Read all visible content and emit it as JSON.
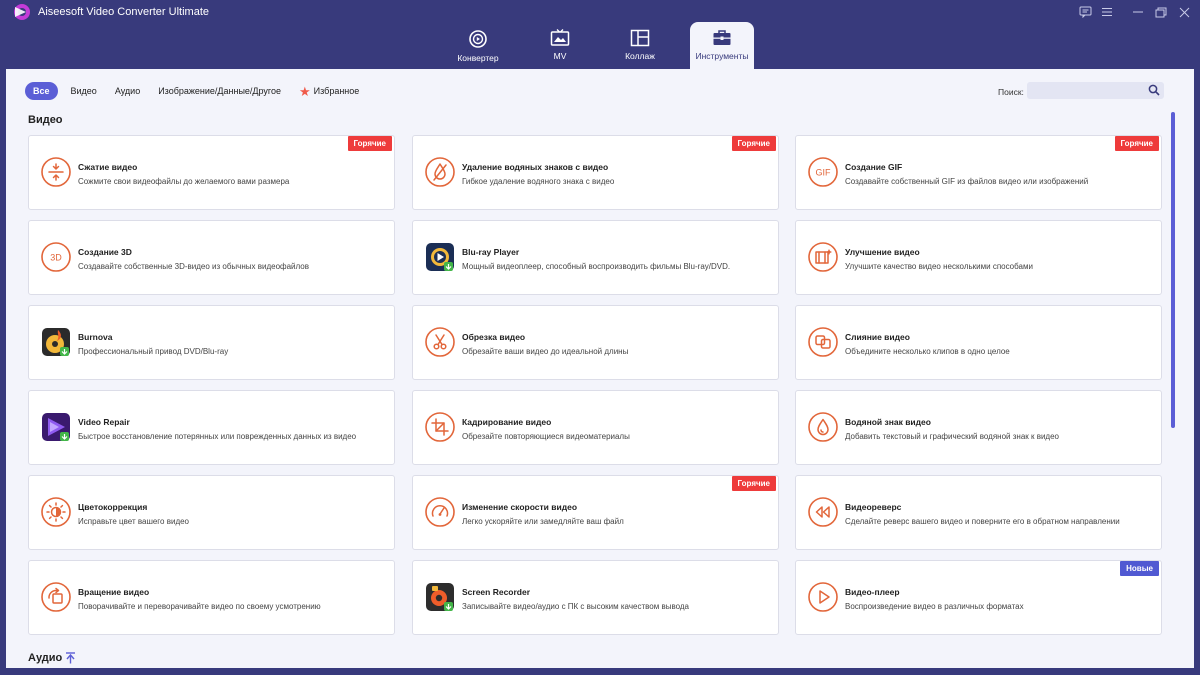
{
  "app": {
    "title": "Aiseesoft Video Converter Ultimate"
  },
  "nav": {
    "tabs": [
      {
        "label": "Конвертер",
        "icon": "convert-icon"
      },
      {
        "label": "MV",
        "icon": "mv-icon"
      },
      {
        "label": "Коллаж",
        "icon": "collage-icon"
      },
      {
        "label": "Инструменты",
        "icon": "toolbox-icon",
        "active": true
      }
    ]
  },
  "filters": {
    "all": "Все",
    "video": "Видео",
    "audio": "Аудио",
    "image": "Изображение/Данные/Другое",
    "favorites": "Избранное"
  },
  "search": {
    "label": "Поиск:",
    "value": ""
  },
  "sections": {
    "video": "Видео",
    "audio": "Аудио"
  },
  "badges": {
    "hot": "Горячие",
    "new": "Новые"
  },
  "tools": [
    {
      "title": "Сжатие видео",
      "desc": "Сожмите свои видеофайлы до желаемого вами размера",
      "icon": "compress-icon",
      "badge": "hot"
    },
    {
      "title": "Удаление водяных знаков с видео",
      "desc": "Гибкое удаление водяного знака с видео",
      "icon": "watermark-remove-icon",
      "badge": "hot"
    },
    {
      "title": "Создание GIF",
      "desc": "Создавайте собственный GIF из файлов видео или изображений",
      "icon": "gif-icon",
      "badge": "hot"
    },
    {
      "title": "Создание 3D",
      "desc": "Создавайте собственные 3D-видео из обычных видеофайлов",
      "icon": "3d-icon"
    },
    {
      "title": "Blu-ray Player",
      "desc": "Мощный видеоплеер, способный воспроизводить фильмы Blu-ray/DVD.",
      "icon": "bluray-player-app-icon"
    },
    {
      "title": "Улучшение видео",
      "desc": "Улучшите качество видео несколькими способами",
      "icon": "enhance-icon"
    },
    {
      "title": "Burnova",
      "desc": "Профессиональный привод DVD/Blu-ray",
      "icon": "burnova-app-icon"
    },
    {
      "title": "Обрезка видео",
      "desc": "Обрезайте ваши видео до идеальной длины",
      "icon": "trim-icon"
    },
    {
      "title": "Слияние видео",
      "desc": "Объедините несколько клипов в одно целое",
      "icon": "merge-icon"
    },
    {
      "title": "Video Repair",
      "desc": "Быстрое восстановление потерянных или поврежденных данных из видео",
      "icon": "video-repair-app-icon"
    },
    {
      "title": "Кадрирование видео",
      "desc": "Обрезайте повторяющиеся видеоматериалы",
      "icon": "crop-icon"
    },
    {
      "title": "Водяной знак видео",
      "desc": "Добавить текстовый и графический водяной знак к видео",
      "icon": "watermark-icon"
    },
    {
      "title": "Цветокоррекция",
      "desc": "Исправьте цвет вашего видео",
      "icon": "color-icon"
    },
    {
      "title": "Изменение скорости видео",
      "desc": "Легко ускоряйте или замедляйте ваш файл",
      "icon": "speed-icon",
      "badge": "hot"
    },
    {
      "title": "Видеореверс",
      "desc": "Сделайте реверс вашего видео и поверните его в обратном направлении",
      "icon": "reverse-icon"
    },
    {
      "title": "Вращение видео",
      "desc": "Поворачивайте и переворачивайте видео по своему усмотрению",
      "icon": "rotate-icon"
    },
    {
      "title": "Screen Recorder",
      "desc": "Записывайте видео/аудио с ПК с высоким качеством вывода",
      "icon": "screen-recorder-app-icon"
    },
    {
      "title": "Видео-плеер",
      "desc": "Воспроизведение видео в различных форматах",
      "icon": "player-icon",
      "badge": "new"
    }
  ],
  "colors": {
    "accent": "#5b5ed6",
    "header": "#383a7c",
    "tool_icon": "#e2663a",
    "hot": "#ee3b3b",
    "new": "#5059d2"
  }
}
